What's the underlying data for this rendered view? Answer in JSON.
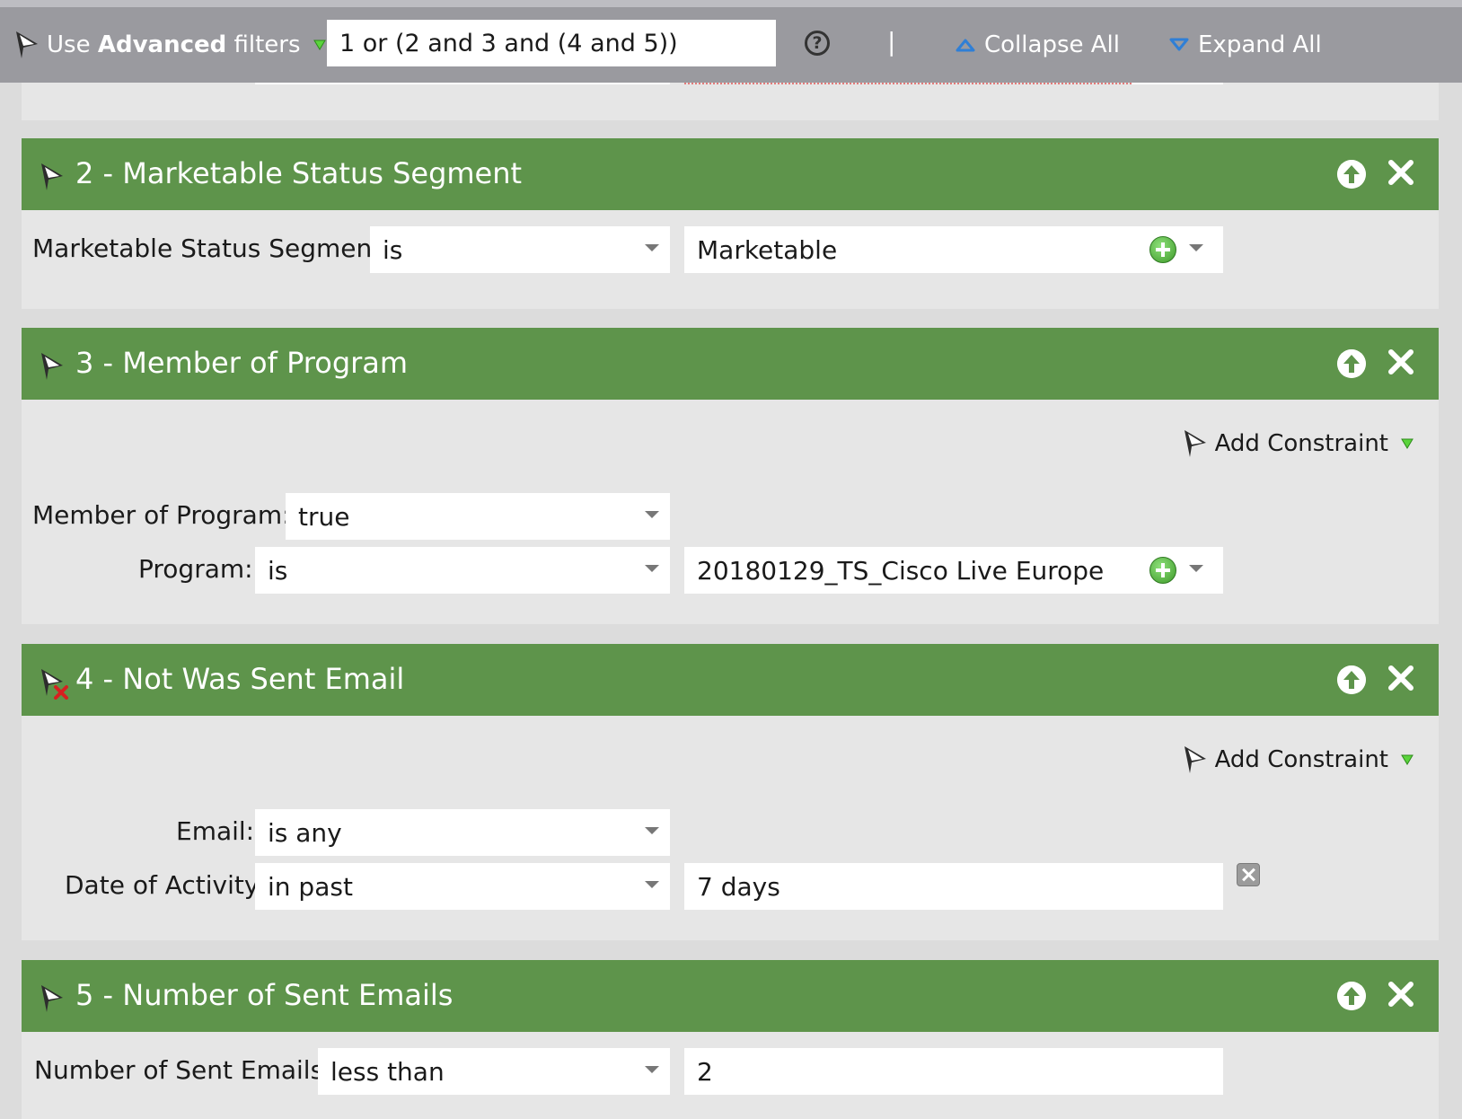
{
  "toolbar": {
    "advanced_prefix": "Use ",
    "advanced_bold": "Advanced",
    "advanced_suffix": " filters",
    "logic_expression": "1 or (2 and 3 and (4 and 5))",
    "help_glyph": "?",
    "separator": "|",
    "collapse_all": "Collapse All",
    "expand_all": "Expand All"
  },
  "filters": [
    {
      "title": "2 - Marketable Status Segment",
      "rows": [
        {
          "label": "Marketable Status Segment:",
          "operator": "is",
          "value": "Marketable"
        }
      ]
    },
    {
      "title": "3 - Member of Program",
      "add_constraint": "Add Constraint",
      "rows": [
        {
          "label": "Member of Program:",
          "operator": "true"
        },
        {
          "label": "Program:",
          "operator": "is",
          "value": "20180129_TS_Cisco Live Europe"
        }
      ]
    },
    {
      "title": "4 - Not Was Sent Email",
      "add_constraint": "Add Constraint",
      "rows": [
        {
          "label": "Email:",
          "operator": "is any"
        },
        {
          "label": "Date of Activity:",
          "operator": "in past",
          "value": "7 days"
        }
      ]
    },
    {
      "title": "5 - Number of Sent Emails",
      "rows": [
        {
          "label": "Number of Sent Emails:",
          "operator": "less than",
          "value": "2"
        }
      ]
    }
  ],
  "colors": {
    "header_green": "#5e944b",
    "toolbar_gray": "#9a9a9f",
    "panel_gray": "#e6e6e6"
  },
  "icons": [
    "filter-icon",
    "not-filter-icon",
    "move-up-icon",
    "close-icon",
    "add-value-icon",
    "help-icon",
    "clear-icon"
  ]
}
